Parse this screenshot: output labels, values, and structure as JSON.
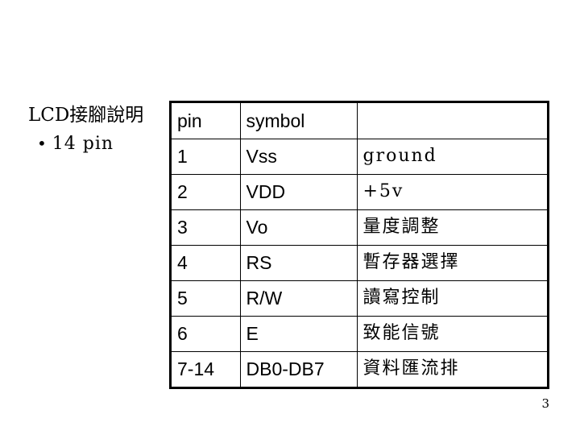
{
  "slide": {
    "page_number": "3",
    "background_color": "#ffffff",
    "text_color": "#000000",
    "border_color": "#000000"
  },
  "caption": {
    "title": "LCD接腳說明",
    "bullet_glyph": "•",
    "bullet_text": "14 pin"
  },
  "table": {
    "headers": [
      "pin",
      "symbol",
      ""
    ],
    "rows": [
      {
        "pin": "1",
        "symbol": "Vss",
        "desc": "ground"
      },
      {
        "pin": "2",
        "symbol": "VDD",
        "desc": "+5v"
      },
      {
        "pin": "3",
        "symbol": "Vo",
        "desc": "量度調整"
      },
      {
        "pin": "4",
        "symbol": "RS",
        "desc": "暫存器選擇"
      },
      {
        "pin": "5",
        "symbol": "R/W",
        "desc": "讀寫控制"
      },
      {
        "pin": "6",
        "symbol": "E",
        "desc": "致能信號"
      },
      {
        "pin": "7-14",
        "symbol": "DB0-DB7",
        "desc": "資料匯流排"
      }
    ]
  }
}
